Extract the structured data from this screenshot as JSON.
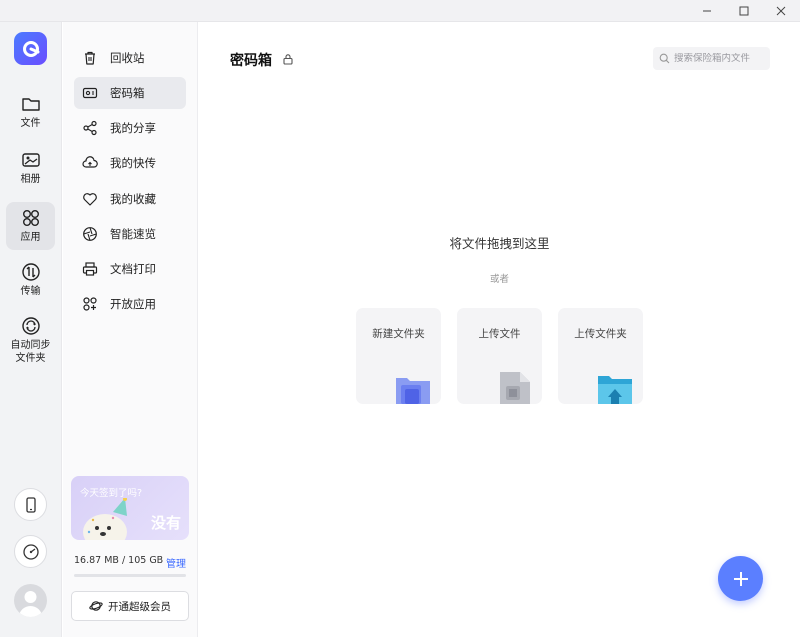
{
  "window": {
    "controls": [
      "minimize-icon",
      "maximize-icon",
      "close-icon"
    ]
  },
  "rail": {
    "items": [
      {
        "label": "文件",
        "icon": "folder-icon"
      },
      {
        "label": "相册",
        "icon": "photo-icon"
      },
      {
        "label": "应用",
        "icon": "apps-icon",
        "active": true
      },
      {
        "label": "传输",
        "icon": "transfer-icon"
      },
      {
        "label": "自动同步\n文件夹",
        "icon": "sync-icon"
      }
    ],
    "bottom_icons": [
      "phone-icon",
      "dashboard-icon",
      "avatar"
    ]
  },
  "sidebar": {
    "items": [
      {
        "label": "回收站",
        "icon": "trash-icon"
      },
      {
        "label": "密码箱",
        "icon": "safe-icon",
        "active": true
      },
      {
        "label": "我的分享",
        "icon": "share-icon"
      },
      {
        "label": "我的快传",
        "icon": "cloud-upload-icon"
      },
      {
        "label": "我的收藏",
        "icon": "heart-icon"
      },
      {
        "label": "智能速览",
        "icon": "aperture-icon"
      },
      {
        "label": "文档打印",
        "icon": "printer-icon"
      },
      {
        "label": "开放应用",
        "icon": "grid-icon"
      }
    ],
    "promo": {
      "question": "今天签到了吗?",
      "answer": "没有"
    },
    "storage": {
      "used_text": "16.87 MB / 105 GB",
      "manage_label": "管理",
      "usage_fraction": 0.0002
    },
    "vip_label": "开通超级会员"
  },
  "main": {
    "title": "密码箱",
    "search_placeholder": "搜索保险箱内文件",
    "drop_text": "将文件拖拽到这里",
    "or_text": "或者",
    "cards": [
      {
        "label": "新建文件夹",
        "icon": "new-folder-icon"
      },
      {
        "label": "上传文件",
        "icon": "upload-file-icon"
      },
      {
        "label": "上传文件夹",
        "icon": "upload-folder-icon"
      }
    ]
  },
  "colors": {
    "accent": "#5b7fff",
    "link": "#3d6bff"
  }
}
